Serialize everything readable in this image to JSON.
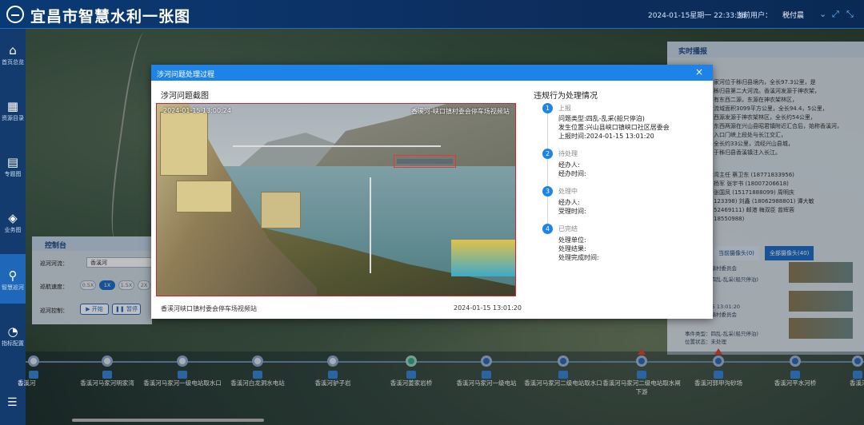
{
  "header": {
    "title": "宜昌市智慧水利一张图",
    "datetime": "2024-01-15星期一 22:33:38",
    "user_label": "当前用户：",
    "user_name": "税付晨"
  },
  "sidebar": {
    "items": [
      {
        "label": "首页总览",
        "icon": "home-icon"
      },
      {
        "label": "资源目录",
        "icon": "grid-icon"
      },
      {
        "label": "专题图",
        "icon": "map-icon"
      },
      {
        "label": "业务图",
        "icon": "layers-icon"
      },
      {
        "label": "智慧巡河",
        "icon": "location-icon"
      },
      {
        "label": "指标配置",
        "icon": "chart-icon"
      }
    ]
  },
  "right_panel": {
    "title": "实时播报",
    "text_lines": [
      "家河位于秭归县境内，全长97.3公里，是",
      "秭归县第二大河流。香溪河发源于神农架，",
      "有东西二源，东源在神农架林区，",
      "流域面积3099平方公里，全长94.4，5公里，",
      "西源发源于神农架林区，全长约54公里，",
      "东西两源在兴山县昭君镇附近汇合后，始称香溪河，",
      "入口门峡上段处与长江交汇，",
      "全长约33公里，流经兴山县城，",
      "于秭归县香溪镇注入长江。"
    ],
    "contacts": [
      "湾主任 蔡卫东 (18771833956)",
      "杨军 张宇书 (18007206618)",
      "张国凤 (15171888099) 周明庆",
      "123398) 刘鑫 (18062988801) 谭大敏",
      "52469111) 邮港 梅双臣 曾辉蓉",
      "18550988)"
    ],
    "cam_tab_current": "当前摄像头(0)",
    "cam_tab_all": "全部摄像头(40)",
    "cam_items": [
      "兴山县峡口镇村委员会",
      "事件类型：四乱-乱采(船只停泊)",
      "发生位置：",
      "2024-01-15 13:01:20",
      "兴山县峡口镇村委员会",
      "事件类型：四乱-乱采(船只停泊)",
      "位置状态：未处理"
    ]
  },
  "control": {
    "title": "控制台",
    "river_label": "巡河河流：",
    "river_value": "香溪河",
    "speed_label": "巡航速度：",
    "speeds": [
      "0.5X",
      "1X",
      "1.5X",
      "2X"
    ],
    "control_label": "巡河控制：",
    "start_label": "开始",
    "pause_label": "暂停"
  },
  "timeline": {
    "stations": [
      "香溪河",
      "香溪河马家河明家湾",
      "香溪河马家河一级电站取水口",
      "香溪河白龙洞水电站",
      "香溪河驴子岩",
      "香溪河姜家岩桥",
      "香溪河马家河一级电站",
      "香溪河马家河二级电站取水口",
      "香溪河马家河二级电站取水闸下游",
      "香溪河郭甲沟砂场",
      "香溪河平水河桥",
      "香溪河"
    ]
  },
  "dialog": {
    "title": "涉河问题处理过程",
    "left_title": "涉河问题截图",
    "right_title": "违规行为处理情况",
    "photo_timestamp": "2024-01-15 13:00:24",
    "photo_location": "香溪河-峡口镇村委会停车场视频站",
    "caption_left": "香溪河峡口镇村委会停车场视频站",
    "caption_right": "2024-01-15 13:01:20",
    "steps": [
      {
        "num": "1",
        "title": "上报",
        "lines": [
          "问题类型:四乱-乱采(船只停泊)",
          "发生位置:兴山县峡口镇峡口社区居委会",
          "上报时间:2024-01-15 13:01:20"
        ]
      },
      {
        "num": "2",
        "title": "待处理",
        "lines": [
          "经办人:",
          "经办时间:"
        ]
      },
      {
        "num": "3",
        "title": "处理中",
        "lines": [
          "经办人:",
          "受理时间:"
        ]
      },
      {
        "num": "4",
        "title": "已完结",
        "lines": [
          "处理单位:",
          "处理结果:",
          "处理完成时间:"
        ]
      }
    ],
    "close_symbol": "×"
  }
}
